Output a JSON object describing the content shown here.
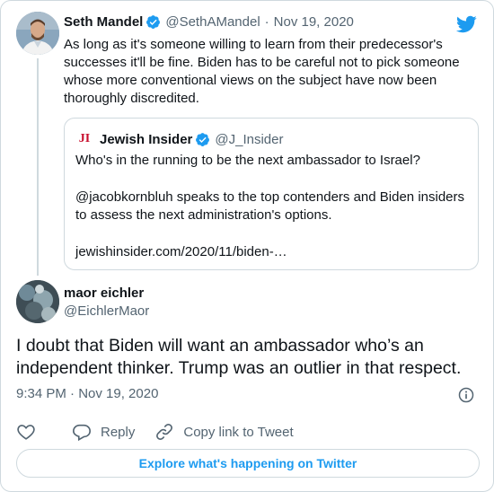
{
  "tweet": {
    "author_name": "Seth Mandel",
    "handle": "@SethAMandel",
    "separator": "·",
    "date": "Nov 19, 2020",
    "text": "As long as it's someone willing to learn from their predecessor's successes it'll be fine. Biden has to be careful not to pick someone whose more conventional views on the subject have now been thoroughly discredited."
  },
  "quoted": {
    "logo_text": "JI",
    "author_name": "Jewish Insider",
    "handle": "@J_Insider",
    "line1": "Who's in the running to be the next ambassador to Israel?",
    "line2": "@jacobkornbluh speaks to the top contenders and Biden insiders to assess the next administration's options.",
    "link": "jewishinsider.com/2020/11/biden-…"
  },
  "reply": {
    "author_name": "maor eichler",
    "handle": "@EichlerMaor",
    "text": "I doubt that Biden will want an ambassador who’s an independent thinker. Trump was an outlier in that respect.",
    "timestamp": "9:34 PM · Nov 19, 2020"
  },
  "actions": {
    "reply_label": "Reply",
    "copy_label": "Copy link to Tweet"
  },
  "explore_label": "Explore what's happening on Twitter",
  "icons": {
    "twitter_bird": "twitter-bird-icon",
    "verified": "verified-badge-icon",
    "like": "heart-icon",
    "reply": "speech-bubble-icon",
    "copy_link": "link-icon",
    "info": "info-icon"
  },
  "colors": {
    "brand_blue": "#1d9bf0",
    "text": "#0f1419",
    "muted": "#536471",
    "border": "#cfd9de",
    "ji_red": "#c8102e"
  }
}
